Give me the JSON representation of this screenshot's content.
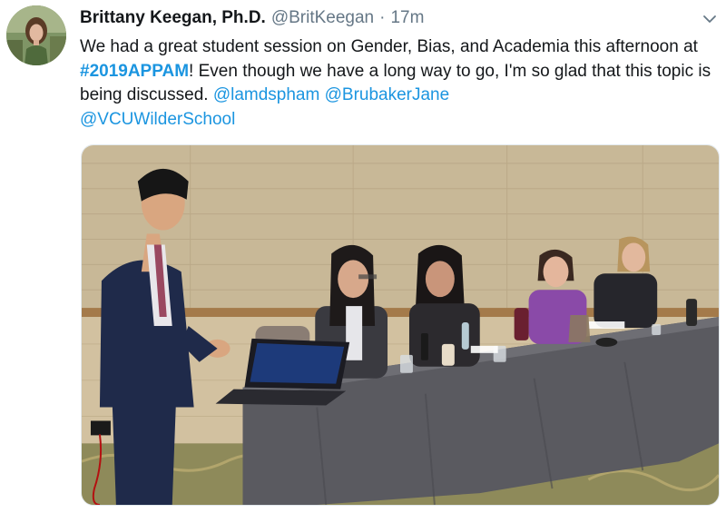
{
  "tweet": {
    "author_name": "Brittany Keegan, Ph.D.",
    "author_handle": "@BritKeegan",
    "separator": "·",
    "timestamp": "17m",
    "text_part1": "We had a great student session on Gender, Bias, and Academia this afternoon at ",
    "hashtag": "#2019APPAM",
    "text_part2": "! Even though we have a long way to go, I'm so glad that this topic is being discussed. ",
    "mentions": [
      "@lamdspham",
      "@BrubakerJane",
      "@VCUWilderSchool"
    ]
  },
  "icons": {
    "caret": "chevron-down-icon"
  },
  "colors": {
    "link": "#1b95e0",
    "secondary_text": "#657786",
    "primary_text": "#14171a"
  }
}
